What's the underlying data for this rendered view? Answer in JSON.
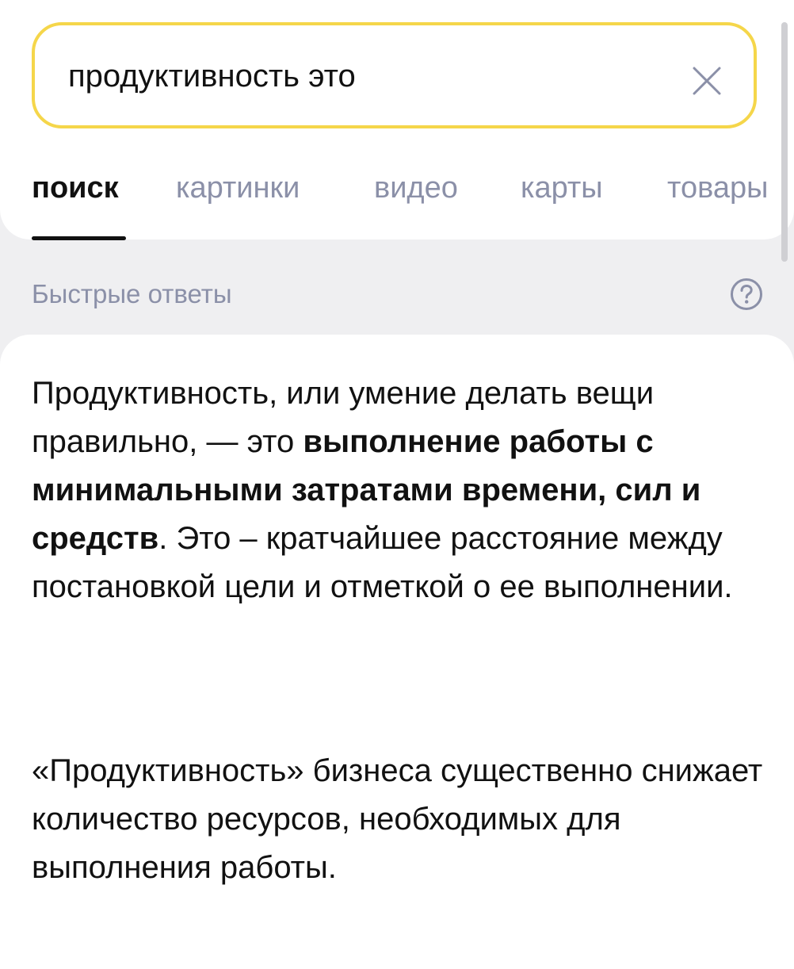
{
  "search": {
    "query": "продуктивность это"
  },
  "icons": {
    "clear": "close-icon",
    "help": "question-circle-icon"
  },
  "colors": {
    "search_border": "#f5d64a",
    "tab_inactive": "#8b90a8",
    "background": "#efeff1"
  },
  "tabs": [
    {
      "label": "поиск",
      "active": true
    },
    {
      "label": "картинки",
      "active": false
    },
    {
      "label": "видео",
      "active": false
    },
    {
      "label": "карты",
      "active": false
    },
    {
      "label": "товары",
      "active": false
    }
  ],
  "quick_answers": {
    "title": "Быстрые ответы"
  },
  "answer": {
    "p1_start": "Продуктивность, или умение делать вещи правильно, — это ",
    "p1_bold": "выполнение работы с минимальными затратами времени, сил и средств",
    "p1_end": ". Это – кратчайшее расстояние между постановкой цели и отметкой о ее выполнении.",
    "p2": "«Продуктивность» бизнеса существенно снижает количество ресурсов, необходимых для выполнения работы."
  }
}
